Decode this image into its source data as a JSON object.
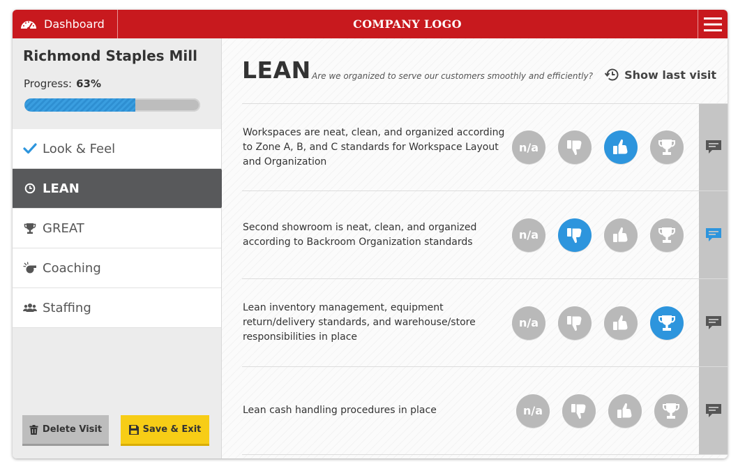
{
  "topbar": {
    "dashboard_label": "Dashboard",
    "logo_text": "COMPANY LOGO",
    "brand_color": "#c8191e"
  },
  "sidebar": {
    "store_name": "Richmond Staples Mill",
    "progress_label": "Progress:",
    "progress_value": "63%",
    "progress_fraction": 0.63,
    "items": [
      {
        "label": "Look & Feel",
        "icon": "check-icon",
        "state": "completed"
      },
      {
        "label": "LEAN",
        "icon": "clock-icon",
        "state": "active"
      },
      {
        "label": "GREAT",
        "icon": "trophy-icon",
        "state": "default"
      },
      {
        "label": "Coaching",
        "icon": "whistle-icon",
        "state": "default"
      },
      {
        "label": "Staffing",
        "icon": "people-icon",
        "state": "default"
      }
    ],
    "delete_label": "Delete Visit",
    "save_label": "Save & Exit"
  },
  "main": {
    "title": "LEAN",
    "subtitle": "Are we organized to serve our customers smoothly and efficiently?",
    "last_visit_label": "Show last visit",
    "option_na_label": "n/a",
    "selected_color": "#2d95dd",
    "questions": [
      {
        "text": "Workspaces are neat, clean, and organized according to Zone A, B, and C standards for Workspace Layout and Organization",
        "selected": "thumbs-up",
        "comment_active": false
      },
      {
        "text": "Second showroom is neat, clean, and organized according to Backroom Organization standards",
        "selected": "thumbs-down",
        "comment_active": true
      },
      {
        "text": "Lean inventory management, equipment return/delivery standards, and warehouse/store responsibilities in place",
        "selected": "trophy",
        "comment_active": false
      },
      {
        "text": "Lean cash handling procedures in place",
        "selected": "none",
        "comment_active": false
      }
    ]
  }
}
